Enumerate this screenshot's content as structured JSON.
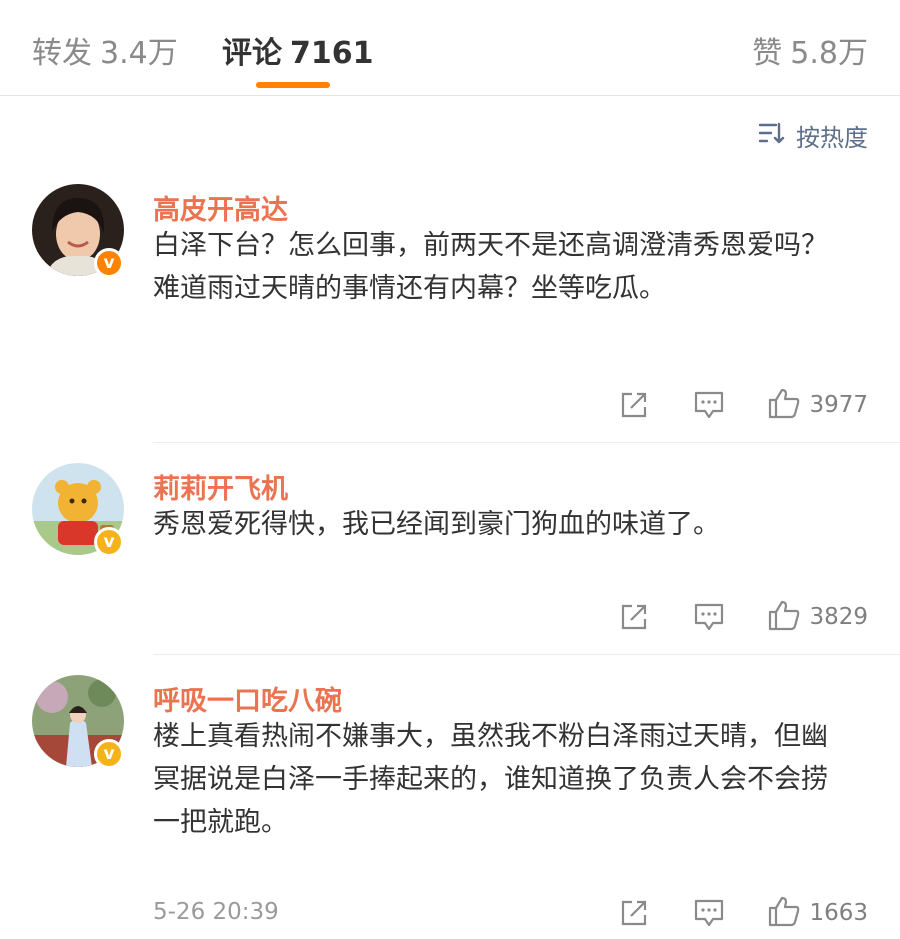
{
  "tabs": {
    "repost": {
      "label": "转发",
      "count": "3.4万"
    },
    "comments": {
      "label": "评论",
      "count": "7161"
    },
    "likes": {
      "label": "赞",
      "count": "5.8万"
    }
  },
  "sort": {
    "label": "按热度",
    "icon": "sort-icon"
  },
  "accent_color": "#ff8200",
  "username_color": "#eb7350",
  "comments": [
    {
      "username": "高皮开高达",
      "text": "白泽下台？怎么回事，前两天不是还高调澄清秀恩爱吗？难道雨过天晴的事情还有内幕？坐等吃瓜。",
      "badge": "v",
      "badge_color": "#ff8200",
      "likes": "3977",
      "timestamp": ""
    },
    {
      "username": "莉莉开飞机",
      "text": "秀恩爱死得快，我已经闻到豪门狗血的味道了。",
      "badge": "v",
      "badge_color": "#f5b31a",
      "likes": "3829",
      "timestamp": ""
    },
    {
      "username": "呼吸一口吃八碗",
      "text": "楼上真看热闹不嫌事大，虽然我不粉白泽雨过天晴，但幽冥据说是白泽一手捧起来的，谁知道换了负责人会不会捞一把就跑。",
      "badge": "v",
      "badge_color": "#f5b31a",
      "likes": "1663",
      "timestamp": "5-26 20:39"
    }
  ]
}
